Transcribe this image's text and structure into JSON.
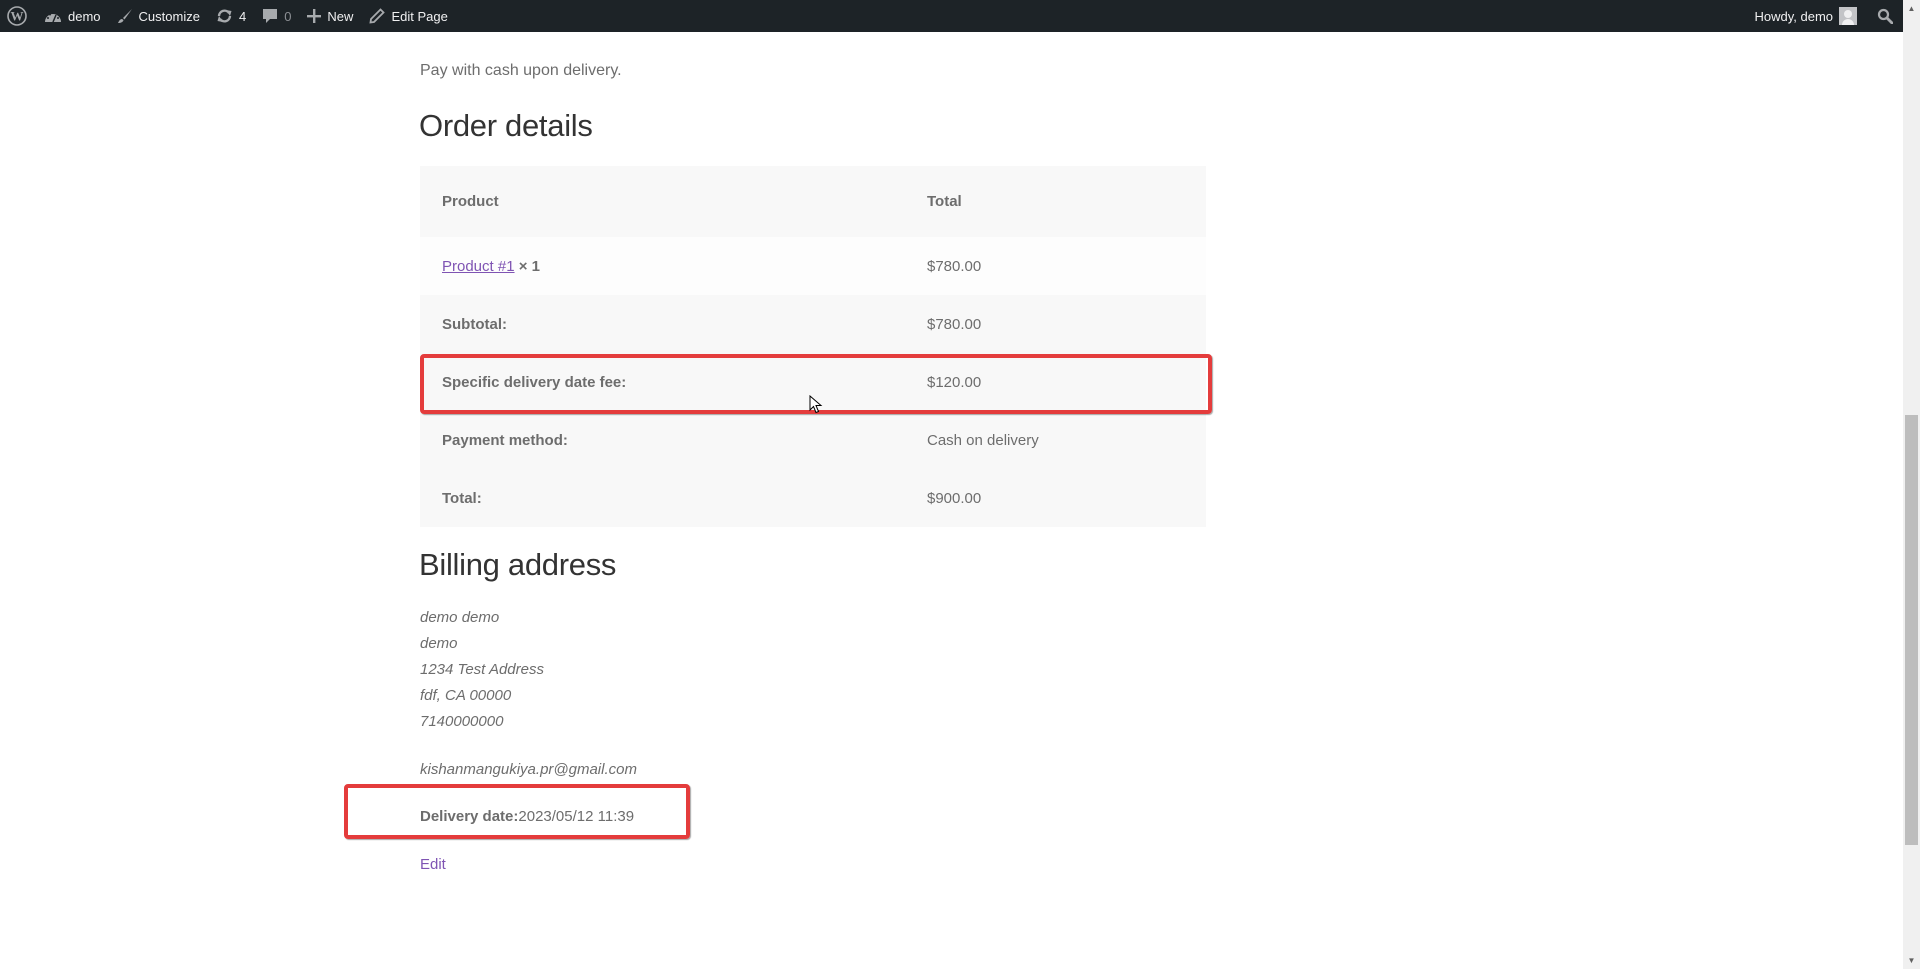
{
  "admin_bar": {
    "site_name": "demo",
    "customize": "Customize",
    "updates_count": "4",
    "comments_count": "0",
    "new": "New",
    "edit_page": "Edit Page",
    "greeting": "Howdy, demo",
    "icons": [
      "wordpress-logo-icon",
      "dashboard-icon",
      "brush-icon",
      "updates-icon",
      "comment-icon",
      "plus-icon",
      "pencil-icon",
      "avatar-icon",
      "search-icon"
    ]
  },
  "payment_note": "Pay with cash upon delivery.",
  "order_details": {
    "title": "Order details",
    "headers": {
      "product": "Product",
      "total": "Total"
    },
    "items": [
      {
        "name": "Product #1",
        "qty": "× 1",
        "total": "$780.00"
      }
    ],
    "totals": [
      {
        "label": "Subtotal:",
        "value": "$780.00"
      },
      {
        "label": "Specific delivery date fee:",
        "value": "$120.00",
        "highlighted": true
      },
      {
        "label": "Payment method:",
        "value": "Cash on delivery"
      },
      {
        "label": "Total:",
        "value": "$900.00"
      }
    ]
  },
  "billing": {
    "title": "Billing address",
    "lines": [
      "demo demo",
      "demo",
      "1234 Test Address",
      "fdf, CA 00000",
      "7140000000"
    ],
    "email": "kishanmangukiya.pr@gmail.com",
    "delivery_label": "Delivery date:",
    "delivery_value": "2023/05/12 11:39",
    "edit": "Edit"
  },
  "colors": {
    "admin_bar": "#1d2327",
    "link": "#7f54b3",
    "highlight": "#e43c3c",
    "table_bg": "#f8f8f8"
  },
  "scrollbar": {
    "position_fraction": 0.6
  }
}
